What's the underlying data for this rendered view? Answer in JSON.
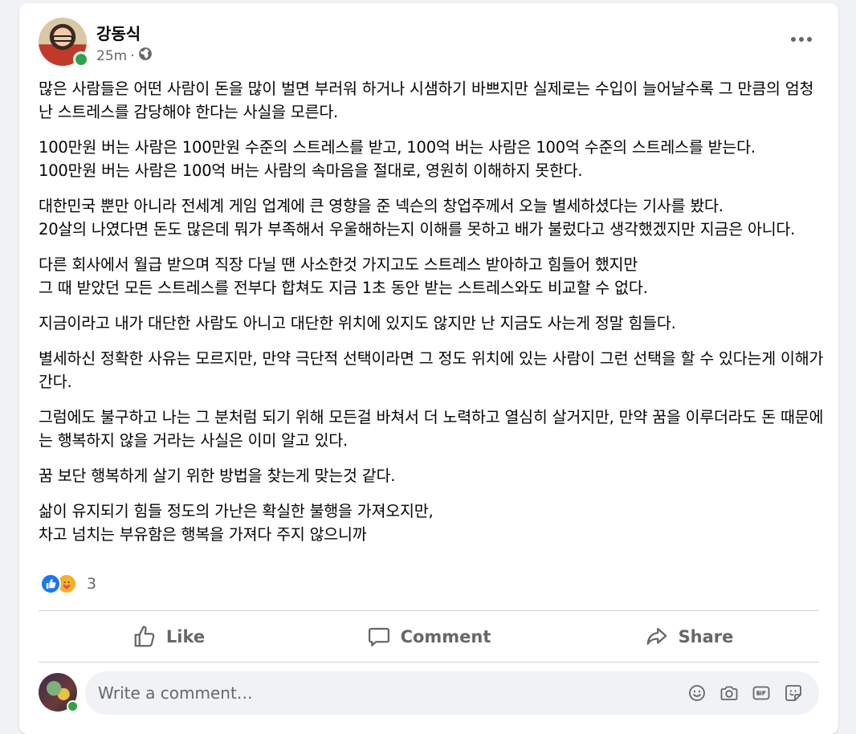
{
  "post": {
    "author": "강동식",
    "time": "25m",
    "separator": "·",
    "privacy_icon": "globe-icon",
    "paragraphs": [
      "많은 사람들은 어떤 사람이 돈을 많이 벌면 부러워 하거나 시샘하기 바쁘지만 실제로는 수입이 늘어날수록 그 만큼의 엄청난 스트레스를 감당해야 한다는 사실을 모른다.",
      "100만원 버는 사람은 100만원 수준의 스트레스를 받고, 100억 버는 사람은 100억 수준의 스트레스를 받는다.\n100만원 버는 사람은 100억 버는 사람의 속마음을 절대로, 영원히 이해하지 못한다.",
      "대한민국 뿐만 아니라 전세계 게임 업계에 큰 영향을 준 넥슨의 창업주께서 오늘 별세하셨다는 기사를 봤다.\n20살의 나였다면 돈도 많은데 뭐가 부족해서 우울해하는지 이해를 못하고 배가 불렀다고 생각했겠지만 지금은 아니다.",
      "다른 회사에서 월급 받으며 직장 다닐 땐 사소한것 가지고도 스트레스 받아하고 힘들어 했지만\n그 때 받았던 모든 스트레스를 전부다 합쳐도 지금 1초 동안 받는 스트레스와도 비교할 수 없다.",
      "지금이라고 내가 대단한 사람도 아니고 대단한 위치에 있지도 않지만 난 지금도 사는게 정말 힘들다.",
      "별세하신 정확한 사유는 모르지만, 만약 극단적 선택이라면 그 정도 위치에 있는 사람이 그런 선택을 할 수 있다는게 이해가 간다.",
      "그럼에도 불구하고 나는 그 분처럼 되기 위해 모든걸 바쳐서 더 노력하고 열심히 살거지만, 만약 꿈을 이루더라도 돈 때문에는 행복하지 않을 거라는 사실은 이미 알고 있다.",
      "꿈 보단 행복하게 살기 위한 방법을 찾는게 맞는것 같다.",
      "삶이 유지되기 힘들 정도의 가난은 확실한 불행을 가져오지만,\n차고 넘치는 부유함은 행복을 가져다 주지 않으니까"
    ],
    "reactions": {
      "types": [
        "like-icon",
        "care-icon"
      ],
      "count": "3"
    }
  },
  "actions": {
    "like": "Like",
    "comment": "Comment",
    "share": "Share"
  },
  "comment_box": {
    "placeholder": "Write a comment…",
    "icons": [
      "emoji-icon",
      "camera-icon",
      "gif-icon",
      "sticker-icon"
    ]
  },
  "colors": {
    "brand_blue": "#1877f2",
    "online_green": "#31a24c",
    "secondary_text": "#65676b"
  }
}
